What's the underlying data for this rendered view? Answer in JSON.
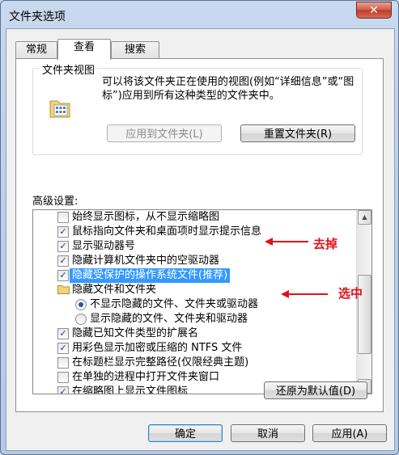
{
  "window": {
    "title": "文件夹选项"
  },
  "tabs": [
    {
      "label": "常规"
    },
    {
      "label": "查看"
    },
    {
      "label": "搜索"
    }
  ],
  "folder_view": {
    "group_title": "文件夹视图",
    "description": "可以将该文件夹正在使用的视图(例如“详细信息”或“图标”)应用到所有这种类型的文件夹中。",
    "apply_button": "应用到文件夹(L)",
    "reset_button": "重置文件夹(R)"
  },
  "advanced": {
    "label": "高级设置:",
    "items": [
      {
        "text": "始终显示图标，从不显示缩略图",
        "type": "checkbox",
        "checked": false
      },
      {
        "text": "鼠标指向文件夹和桌面项时显示提示信息",
        "type": "checkbox",
        "checked": true
      },
      {
        "text": "显示驱动器号",
        "type": "checkbox",
        "checked": true
      },
      {
        "text": "隐藏计算机文件夹中的空驱动器",
        "type": "checkbox",
        "checked": true
      },
      {
        "text": "隐藏受保护的操作系统文件(推荐)",
        "type": "checkbox",
        "checked": true,
        "selected": true
      },
      {
        "text": "隐藏文件和文件夹",
        "type": "folder"
      },
      {
        "text": "不显示隐藏的文件、文件夹或驱动器",
        "type": "radio",
        "checked": true
      },
      {
        "text": "显示隐藏的文件、文件夹和驱动器",
        "type": "radio",
        "checked": false
      },
      {
        "text": "隐藏已知文件类型的扩展名",
        "type": "checkbox",
        "checked": true
      },
      {
        "text": "用彩色显示加密或压缩的 NTFS 文件",
        "type": "checkbox",
        "checked": true
      },
      {
        "text": "在标题栏显示完整路径(仅限经典主题)",
        "type": "checkbox",
        "checked": false
      },
      {
        "text": "在单独的进程中打开文件夹窗口",
        "type": "checkbox",
        "checked": false
      },
      {
        "text": "在缩略图上显示文件图标",
        "type": "checkbox",
        "checked": true
      }
    ],
    "restore_button": "还原为默认值(D)"
  },
  "annotations": {
    "remove": "去掉",
    "select": "选中"
  },
  "footer": {
    "ok": "确定",
    "cancel": "取消",
    "apply": "应用(A)"
  },
  "colors": {
    "selection": "#3399ff",
    "annotation": "#e0111a"
  }
}
